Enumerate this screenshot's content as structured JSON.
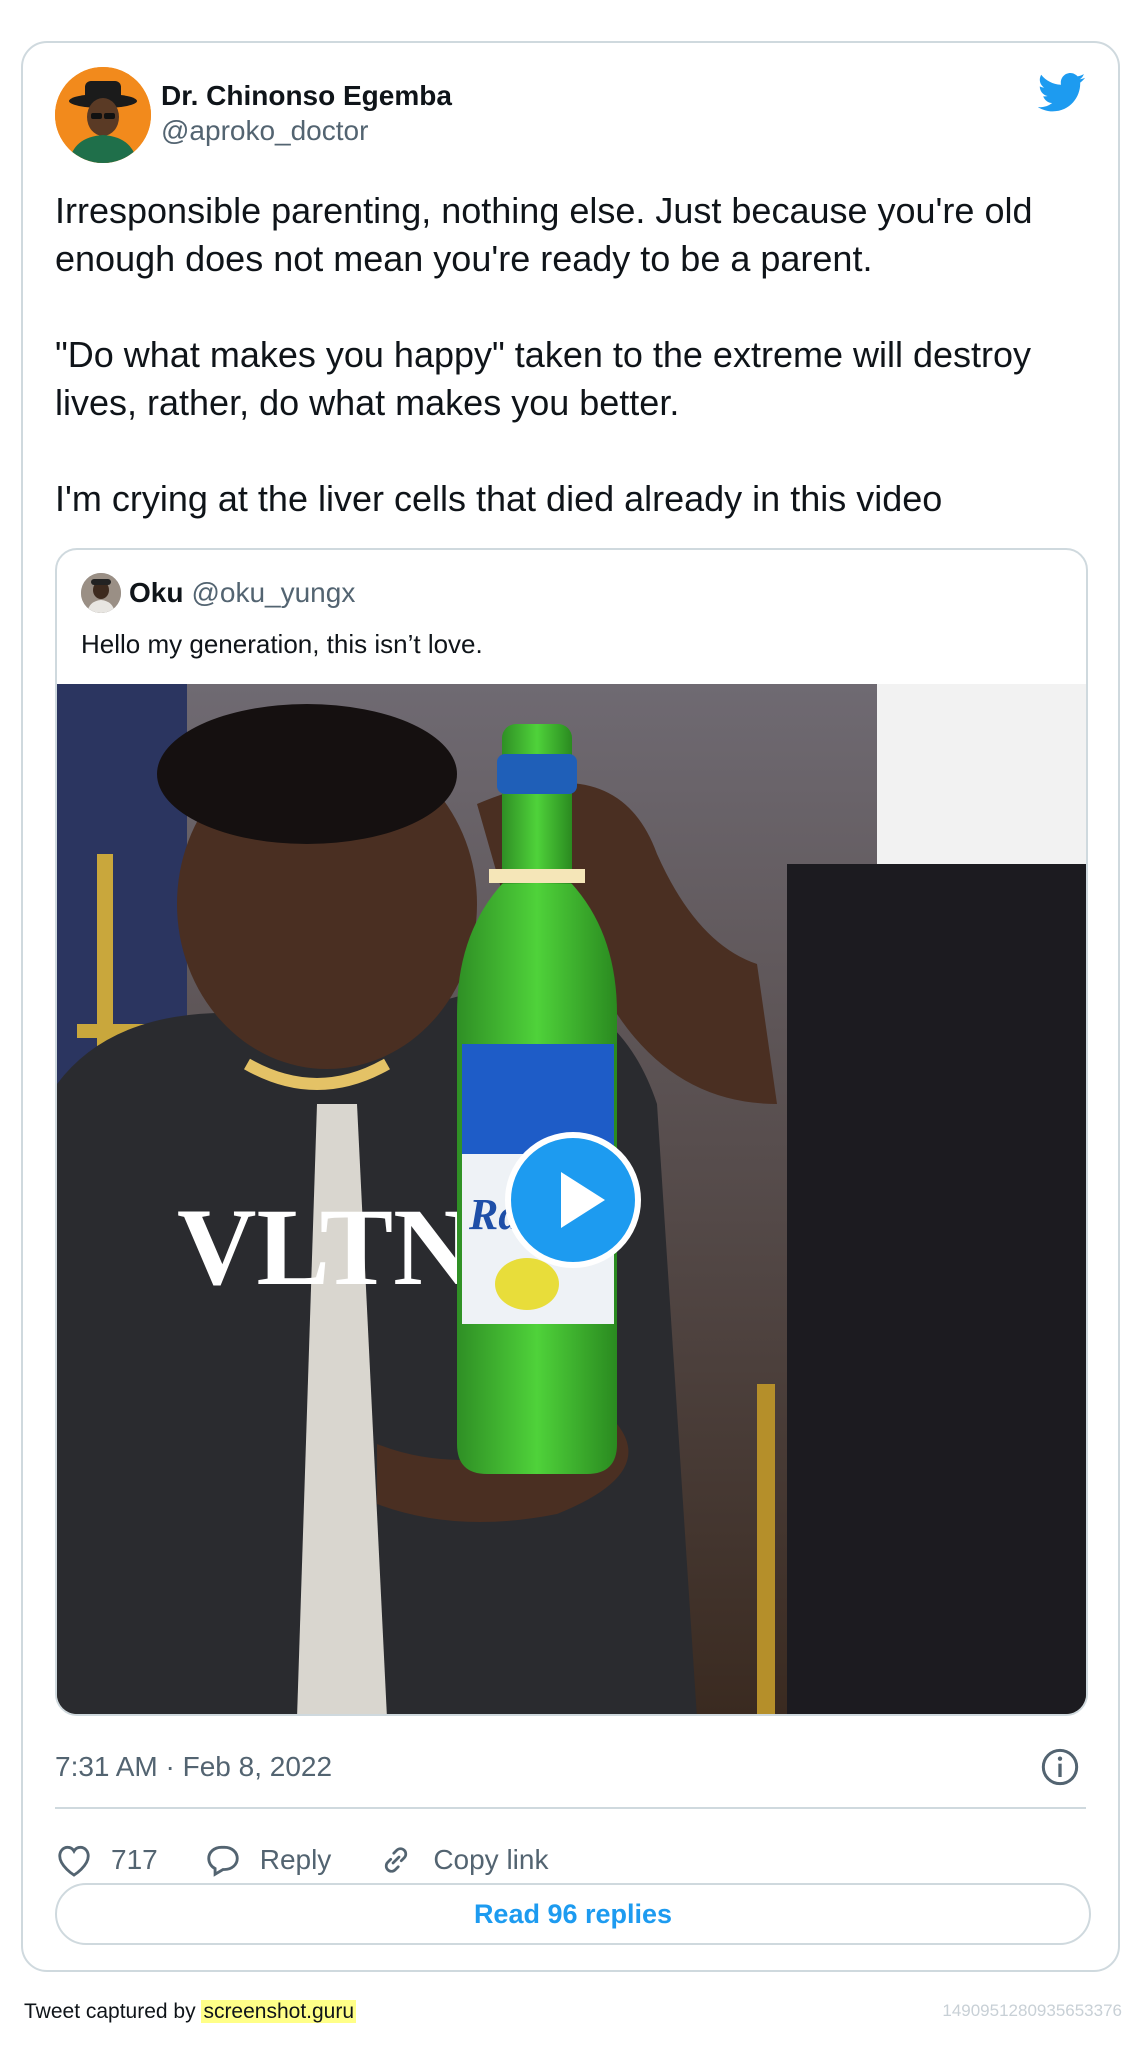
{
  "author": {
    "display_name": "Dr. Chinonso Egemba",
    "handle": "@aproko_doctor",
    "avatar_color": "#f28a1c"
  },
  "tweet": {
    "text": "Irresponsible parenting, nothing else. Just because you're old enough does not mean you're ready to be a parent.\n\n\"Do what makes you happy\" taken to the extreme will destroy lives, rather, do what makes you better.\n\nI'm crying at the liver cells that died already in this video",
    "timestamp": "7:31 AM · Feb 8, 2022"
  },
  "quoted_tweet": {
    "display_name": "Oku",
    "handle": "@oku_yungx",
    "text": "Hello my generation, this isn’t love."
  },
  "media": {
    "bottle_label": "Radler",
    "jacket_print": "VLTN"
  },
  "actions": {
    "likes": "717",
    "reply_label": "Reply",
    "copy_link_label": "Copy link"
  },
  "read_replies_label": "Read 96 replies",
  "footer": {
    "captured_by": "Tweet captured by ",
    "brand": "screenshot.guru",
    "tweet_id": "1490951280935653376"
  },
  "colors": {
    "accent": "#1d9bf0",
    "border": "#cfd9de",
    "secondary_text": "#536471"
  },
  "icons": [
    "twitter-bird-icon",
    "info-icon",
    "heart-icon",
    "reply-bubble-icon",
    "link-icon",
    "play-icon"
  ]
}
